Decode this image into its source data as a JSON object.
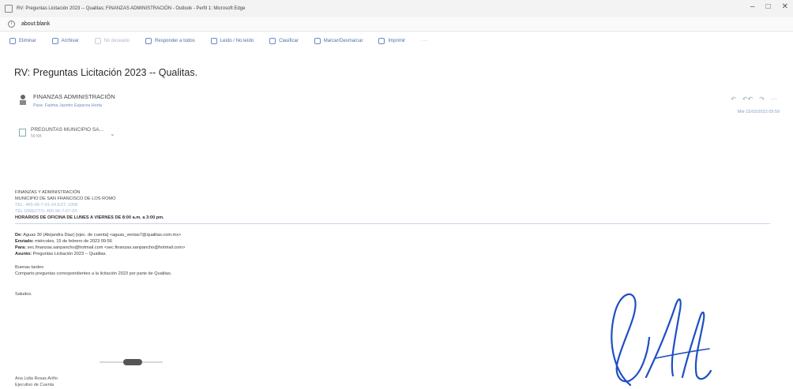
{
  "window": {
    "title": "RV: Preguntas Licitación 2023 -- Qualitas; FINANZAS ADMINISTRACIÓN - Outlook - Perfil 1: Microsoft Edge",
    "controls": [
      "–",
      "□",
      "✕"
    ]
  },
  "address": {
    "url": "about:blank"
  },
  "toolbar": {
    "items": [
      {
        "label": "Eliminar",
        "icon": "trash-icon",
        "enabled": true
      },
      {
        "label": "Archivar",
        "icon": "archive-icon",
        "enabled": true
      },
      {
        "label": "No deseado",
        "icon": "block-icon",
        "enabled": false
      },
      {
        "label": "Responder a todos",
        "icon": "reply-all-icon",
        "enabled": true
      },
      {
        "label": "Leído / No leído",
        "icon": "envelope-icon",
        "enabled": true
      },
      {
        "label": "Clasificar",
        "icon": "tag-icon",
        "enabled": true
      },
      {
        "label": "Marcar/Desmarcar",
        "icon": "flag-icon",
        "enabled": true
      },
      {
        "label": "Imprimir",
        "icon": "printer-icon",
        "enabled": true
      }
    ],
    "more": "···"
  },
  "email": {
    "subject": "RV: Preguntas Licitación 2023 -- Qualitas.",
    "sender": "FINANZAS ADMINISTRACIÓN",
    "to": "Para:  Fatima Jasmin Esparza Horta",
    "date": "Mié 15/02/2023 09:59",
    "actions": [
      "↶",
      "↶↶",
      "↷",
      "···"
    ],
    "attachment": {
      "name": "PREGUNTAS MUNICIPIO SA...",
      "size": "59 KB"
    },
    "signature_lines": [
      {
        "text": "FINANZAS Y ADMINISTRACIÓN",
        "style": "normal"
      },
      {
        "text": "MUNICIPIO DE SAN FRANCISCO DE LOS ROMO",
        "style": "normal"
      },
      {
        "text": "TEL: 465-96-7-01-24 EXT. 1008",
        "style": "blue"
      },
      {
        "text": "TEL DIRECTO: 465-96-7-07-03",
        "style": "blue"
      },
      {
        "text": "HORARIOS DE OFICINA DE LUNES A VIERNES DE 8:00 a.m. a 3:00 pm.",
        "style": "bold"
      }
    ],
    "forward_header": [
      {
        "label": "De:",
        "value": " Aguas 30 (Alejandra Diaz) [ejec. de cuenta] <aguas_ventas7@qualitas.com.mx>"
      },
      {
        "label": "Enviado:",
        "value": " miércoles, 15 de febrero de 2023 09:56"
      },
      {
        "label": "Para:",
        "value": " sec.finanzas.sanpancho@hotmail.com <sec.finanzas.sanpancho@hotmail.com>"
      },
      {
        "label": "Asunto:",
        "value": " Preguntas Licitación 2023 -- Qualitas."
      }
    ],
    "greeting": "Buenas tardes",
    "message": "Comparto preguntas correspondientes a la licitación 2023 por parte de Qualitas.",
    "closing": "Saludos.",
    "rep_name": "Ana Lidia Rosas Ariño",
    "rep_title": "Ejecutivo de Cuenta"
  },
  "colors": {
    "link_blue": "#6a8dc0",
    "toolbar_blue": "#4a6fa5",
    "signature_ink": "#1f4fc4"
  }
}
